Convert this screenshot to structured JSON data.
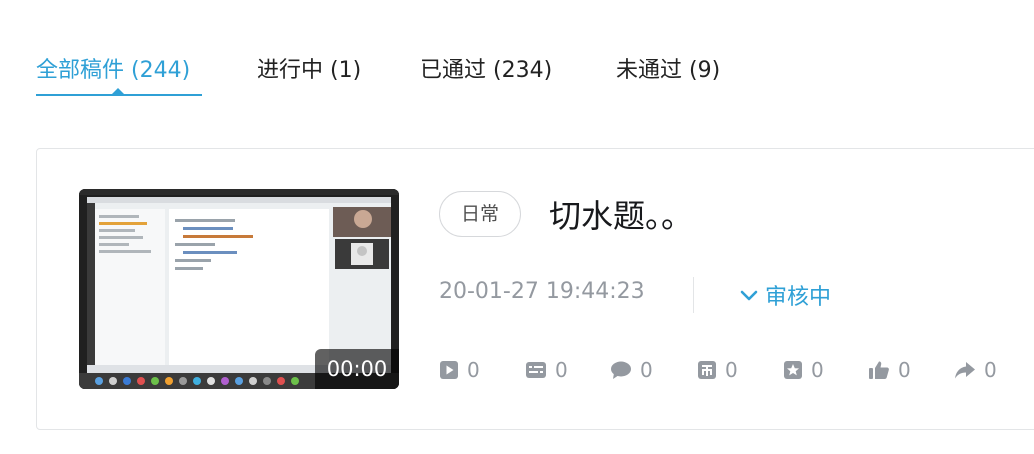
{
  "tabs": [
    {
      "label": "全部稿件 (244)",
      "active": true
    },
    {
      "label": "进行中 (1)",
      "active": false
    },
    {
      "label": "已通过 (234)",
      "active": false
    },
    {
      "label": "未通过 (9)",
      "active": false
    }
  ],
  "accent_color": "#2fa0d6",
  "video": {
    "duration": "00:00",
    "tag": "日常",
    "title": "切水题。。",
    "date": "20-01-27 19:44:23",
    "status": "审核中",
    "status_icon": "chevron-down-icon",
    "stats": [
      {
        "icon": "play-icon",
        "value": "0"
      },
      {
        "icon": "danmaku-icon",
        "value": "0"
      },
      {
        "icon": "comment-icon",
        "value": "0"
      },
      {
        "icon": "coin-icon",
        "value": "0"
      },
      {
        "icon": "favorite-icon",
        "value": "0"
      },
      {
        "icon": "like-icon",
        "value": "0"
      },
      {
        "icon": "share-icon",
        "value": "0"
      }
    ]
  }
}
